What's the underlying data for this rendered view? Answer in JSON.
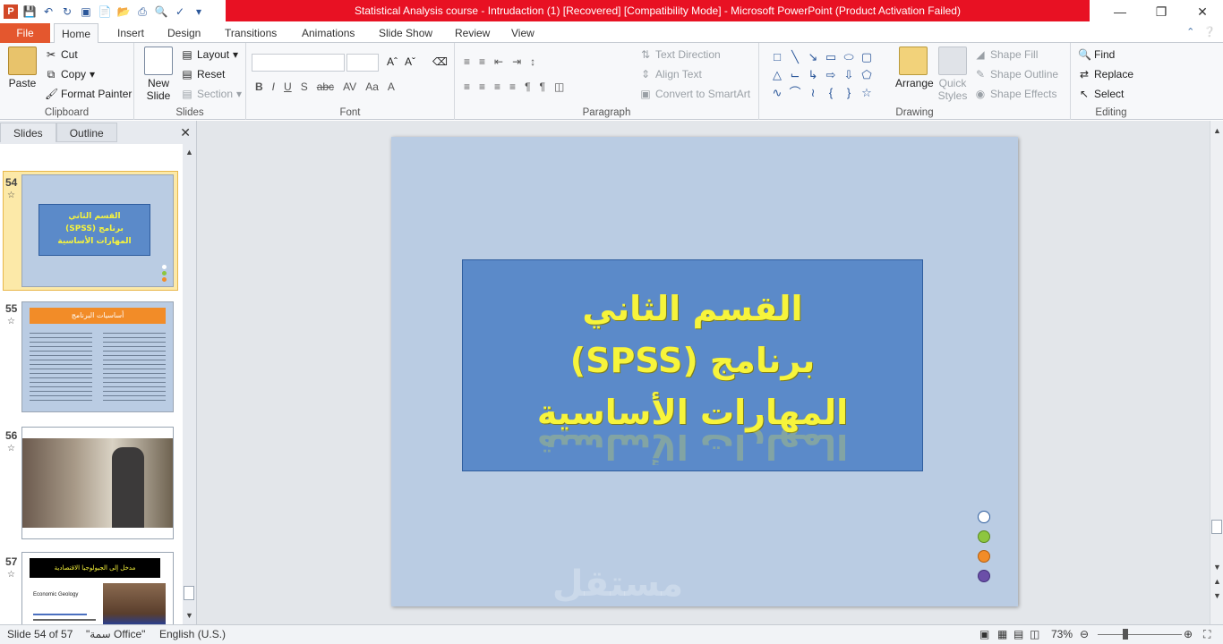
{
  "window": {
    "title": "Statistical Analysis course - Intrudaction (1) [Recovered] [Compatibility Mode] - Microsoft PowerPoint (Product Activation Failed)",
    "app_icon": "P",
    "colors": {
      "title_bar": "#e81123",
      "file_tab": "#e4572e",
      "slide_bg": "#bacce3",
      "title_box": "#5b8ac9",
      "title_text": "#f7f43b"
    }
  },
  "tabs": [
    "File",
    "Home",
    "Insert",
    "Design",
    "Transitions",
    "Animations",
    "Slide Show",
    "Review",
    "View"
  ],
  "active_tab": "Home",
  "ribbon": {
    "clipboard": {
      "label": "Clipboard",
      "paste": "Paste",
      "cut": "Cut",
      "copy": "Copy",
      "format_painter": "Format Painter"
    },
    "slides": {
      "label": "Slides",
      "new_slide": "New Slide",
      "layout": "Layout",
      "reset": "Reset",
      "section": "Section"
    },
    "font": {
      "label": "Font",
      "bold": "B",
      "italic": "I",
      "underline": "U",
      "shadow": "S",
      "strike": "abc",
      "spacing": "AV",
      "case": "Aa",
      "color": "A"
    },
    "paragraph": {
      "label": "Paragraph",
      "text_direction": "Text Direction",
      "align_text": "Align Text",
      "convert_smartart": "Convert to SmartArt"
    },
    "drawing": {
      "label": "Drawing",
      "arrange": "Arrange",
      "quick_styles": "Quick Styles",
      "shape_fill": "Shape Fill",
      "shape_outline": "Shape Outline",
      "shape_effects": "Shape Effects"
    },
    "editing": {
      "label": "Editing",
      "find": "Find",
      "replace": "Replace",
      "select": "Select"
    }
  },
  "left_panel": {
    "tabs": [
      "Slides",
      "Outline"
    ],
    "slides": [
      {
        "num": "54",
        "title_lines": [
          "القسم الثاني",
          "برنامج (SPSS)",
          "المهارات الأساسية"
        ]
      },
      {
        "num": "55",
        "header": "أساسيات البرنامج"
      },
      {
        "num": "56"
      },
      {
        "num": "57",
        "header": "مدخل إلى الجيولوجيا الاقتصادية",
        "caption": "Economic Geology"
      }
    ]
  },
  "slide": {
    "title_lines": [
      "القسم الثاني",
      "برنامج (SPSS)",
      "المهارات الأساسية"
    ],
    "dots": [
      "#ffffff",
      "#8dc63f",
      "#f28c28",
      "#6b4fa8"
    ],
    "watermark": "مستقل"
  },
  "status": {
    "slide_info": "Slide 54 of 57",
    "theme": "\"سمة Office\"",
    "language": "English (U.S.)",
    "zoom": "73%"
  }
}
